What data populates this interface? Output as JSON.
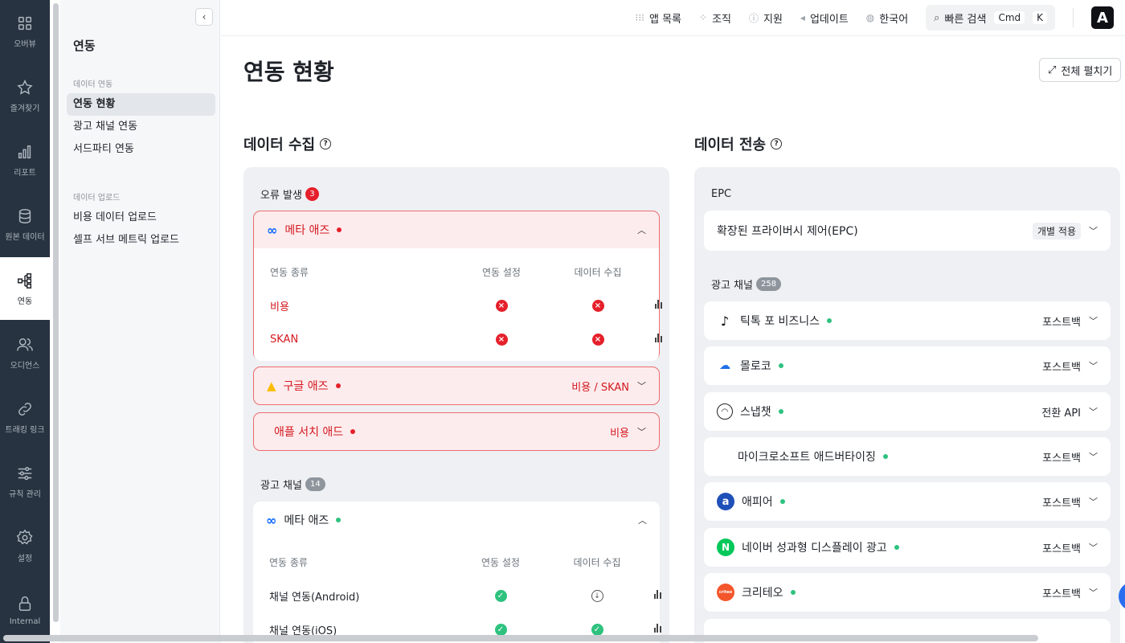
{
  "rail": [
    {
      "label": "오버뷰",
      "icon": "grid-icon"
    },
    {
      "label": "즐겨찾기",
      "icon": "star-icon"
    },
    {
      "label": "리포트",
      "icon": "bar-chart-icon"
    },
    {
      "label": "원본 데이터",
      "icon": "database-icon"
    },
    {
      "label": "연동",
      "icon": "integration-icon"
    },
    {
      "label": "오디언스",
      "icon": "users-icon"
    },
    {
      "label": "트래킹 링크",
      "icon": "link-icon"
    },
    {
      "label": "규칙 관리",
      "icon": "sliders-icon"
    },
    {
      "label": "설정",
      "icon": "gear-icon"
    },
    {
      "label": "Internal",
      "icon": "lock-icon"
    }
  ],
  "subnav": {
    "title": "연동",
    "section1": "데이터 연동",
    "items1": [
      "연동 현황",
      "광고 채널 연동",
      "서드파티 연동"
    ],
    "section2": "데이터 업로드",
    "items2": [
      "비용 데이터 업로드",
      "셀프 서브 메트릭 업로드"
    ]
  },
  "topbar": {
    "apps": "앱 목록",
    "org": "조직",
    "support": "지원",
    "updates": "업데이트",
    "language": "한국어",
    "search": "빠른 검색",
    "kbd1": "Cmd",
    "kbd2": "K",
    "logo": "A"
  },
  "main": {
    "title": "연동 현황",
    "expand_all": "전체 펼치기"
  },
  "collect": {
    "title": "데이터 수집",
    "error_label": "오류 발생",
    "error_count": "3",
    "meta_error": {
      "name": "메타 애즈",
      "headers": [
        "연동 종류",
        "연동 설정",
        "데이터 수집"
      ],
      "rows": [
        {
          "type": "비용",
          "setup": "error",
          "collect": "error"
        },
        {
          "type": "SKAN",
          "setup": "error",
          "collect": "error"
        }
      ]
    },
    "google": {
      "name": "구글 애즈",
      "detail": "비용 / SKAN"
    },
    "apple": {
      "name": "애플 서치 애드",
      "detail": "비용"
    },
    "channel_label": "광고 채널",
    "channel_count": "14",
    "meta_ok": {
      "name": "메타 애즈",
      "headers": [
        "연동 종류",
        "연동 설정",
        "데이터 수집"
      ],
      "rows": [
        {
          "type": "채널 연동(Android)",
          "setup": "ok",
          "collect": "pending"
        },
        {
          "type": "채널 연동(iOS)",
          "setup": "ok",
          "collect": "ok"
        }
      ]
    }
  },
  "transfer": {
    "title": "데이터 전송",
    "epc_label": "EPC",
    "epc": {
      "name": "확장된 프라이버시 제어(EPC)",
      "tag": "개별 적용"
    },
    "channel_label": "광고 채널",
    "channel_count": "258",
    "channels": [
      {
        "name": "틱톡 포 비즈니스",
        "mode": "포스트백",
        "icon": "tiktok-icon"
      },
      {
        "name": "몰로코",
        "mode": "포스트백",
        "icon": "moloco-icon"
      },
      {
        "name": "스냅챗",
        "mode": "전환 API",
        "icon": "snapchat-icon"
      },
      {
        "name": "마이크로소프트 애드버타이징",
        "mode": "포스트백",
        "icon": "microsoft-icon"
      },
      {
        "name": "애피어",
        "mode": "포스트백",
        "icon": "appier-icon"
      },
      {
        "name": "네이버 성과형 디스플레이 광고",
        "mode": "포스트백",
        "icon": "naver-icon"
      },
      {
        "name": "크리테오",
        "mode": "포스트백",
        "icon": "criteo-icon"
      }
    ]
  }
}
